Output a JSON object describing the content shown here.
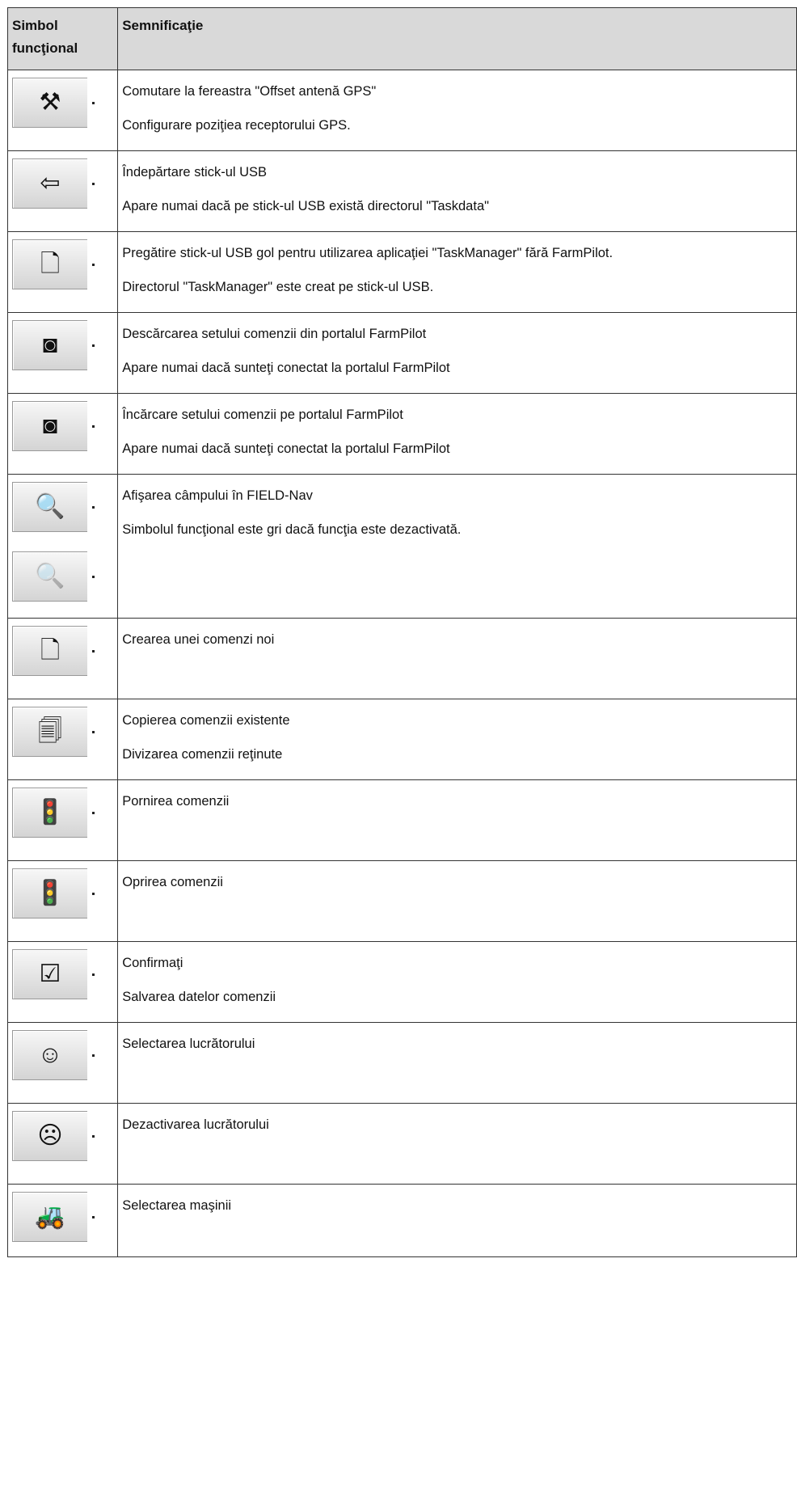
{
  "header": {
    "col1": "Simbol funcţional",
    "col2": "Semnificaţie"
  },
  "rows": [
    {
      "icon": "tools-icon",
      "glyph": "⚒",
      "lines": [
        "Comutare la fereastra \"Offset antenă GPS\"",
        "Configurare poziţiea receptorului GPS."
      ]
    },
    {
      "icon": "usb-remove-icon",
      "glyph": "⇦",
      "lines": [
        "Îndepărtare stick-ul USB",
        "Apare numai dacă pe stick-ul USB există directorul \"Taskdata\""
      ]
    },
    {
      "icon": "usb-prepare-icon",
      "glyph": "🗋",
      "lines": [
        "Pregătire stick-ul USB gol pentru utilizarea aplicaţiei \"TaskManager\" fără FarmPilot.",
        "Directorul \"TaskManager\" este creat pe stick-ul USB."
      ]
    },
    {
      "icon": "download-portal-icon",
      "glyph": "◙",
      "lines": [
        "Descărcarea setului comenzii din portalul FarmPilot",
        "Apare numai dacă sunteţi conectat la portalul FarmPilot"
      ]
    },
    {
      "icon": "upload-portal-icon",
      "glyph": "◙",
      "lines": [
        "Încărcare setului comenzii pe portalul FarmPilot",
        "Apare numai dacă sunteţi conectat la portalul FarmPilot"
      ]
    },
    {
      "icon": "field-view-icon",
      "glyph": "🔍",
      "lines": [
        "Afişarea câmpului în FIELD-Nav",
        "Simbolul funcţional este gri dacă funcţia este dezactivată."
      ]
    },
    {
      "icon": "new-task-icon",
      "glyph": "🗋",
      "lines": [
        "Crearea unei comenzi noi"
      ]
    },
    {
      "icon": "copy-task-icon",
      "glyph": "🗐",
      "lines": [
        "Copierea comenzii existente",
        "Divizarea comenzii reţinute"
      ]
    },
    {
      "icon": "start-task-icon",
      "glyph": "🚦",
      "lines": [
        "Pornirea comenzii"
      ]
    },
    {
      "icon": "stop-task-icon",
      "glyph": "🚦",
      "lines": [
        "Oprirea comenzii"
      ]
    },
    {
      "icon": "confirm-icon",
      "glyph": "☑",
      "lines": [
        "Confirmaţi",
        "Salvarea datelor comenzii"
      ]
    },
    {
      "icon": "select-worker-icon",
      "glyph": "☺",
      "lines": [
        "Selectarea lucrătorului"
      ]
    },
    {
      "icon": "deactivate-worker-icon",
      "glyph": "☹",
      "lines": [
        "Dezactivarea lucrătorului"
      ]
    },
    {
      "icon": "select-machine-icon",
      "glyph": "🚜",
      "lines": [
        "Selectarea maşinii"
      ]
    }
  ]
}
